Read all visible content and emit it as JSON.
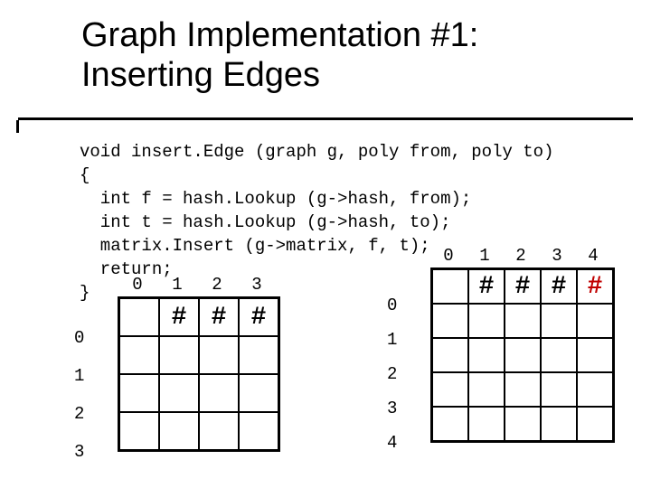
{
  "title_line1": "Graph Implementation #1:",
  "title_line2": "Inserting Edges",
  "code": {
    "l1": "void insert.Edge (graph g, poly from, poly to)",
    "l2": "{",
    "l3": "  int f = hash.Lookup (g->hash, from);",
    "l4": "  int t = hash.Lookup (g->hash, to);",
    "l5": "  matrix.Insert (g->matrix, f, t);",
    "l6": "  return;",
    "l7": "}"
  },
  "left_matrix": {
    "cols": [
      "0",
      "1",
      "2",
      "3"
    ],
    "rows": [
      "0",
      "1",
      "2",
      "3"
    ],
    "cells": [
      [
        "",
        "#",
        "#",
        "#"
      ],
      [
        "",
        "",
        "",
        ""
      ],
      [
        "",
        "",
        "",
        ""
      ],
      [
        "",
        "",
        "",
        ""
      ]
    ]
  },
  "right_matrix": {
    "cols": [
      "0",
      "1",
      "2",
      "3",
      "4"
    ],
    "rows": [
      "0",
      "1",
      "2",
      "3",
      "4"
    ],
    "cells": [
      [
        "",
        "#",
        "#",
        "#",
        "#"
      ],
      [
        "",
        "",
        "",
        "",
        ""
      ],
      [
        "",
        "",
        "",
        "",
        ""
      ],
      [
        "",
        "",
        "",
        "",
        ""
      ],
      [
        "",
        "",
        "",
        "",
        ""
      ]
    ]
  },
  "chart_data": [
    {
      "type": "table",
      "title": "Left adjacency matrix (4x4)",
      "row_labels": [
        "0",
        "1",
        "2",
        "3"
      ],
      "col_labels": [
        "0",
        "1",
        "2",
        "3"
      ],
      "values": [
        [
          "",
          "#",
          "#",
          "#"
        ],
        [
          "",
          "",
          "",
          ""
        ],
        [
          "",
          "",
          "",
          ""
        ],
        [
          "",
          "",
          "",
          ""
        ]
      ]
    },
    {
      "type": "table",
      "title": "Right adjacency matrix (5x5)",
      "row_labels": [
        "0",
        "1",
        "2",
        "3",
        "4"
      ],
      "col_labels": [
        "0",
        "1",
        "2",
        "3",
        "4"
      ],
      "values": [
        [
          "",
          "#",
          "#",
          "#",
          "#"
        ],
        [
          "",
          "",
          "",
          "",
          ""
        ],
        [
          "",
          "",
          "",
          "",
          ""
        ],
        [
          "",
          "",
          "",
          "",
          ""
        ],
        [
          "",
          "",
          "",
          "",
          ""
        ]
      ],
      "highlighted_cell": {
        "row": 0,
        "col": 4,
        "color": "#c00000"
      }
    }
  ]
}
